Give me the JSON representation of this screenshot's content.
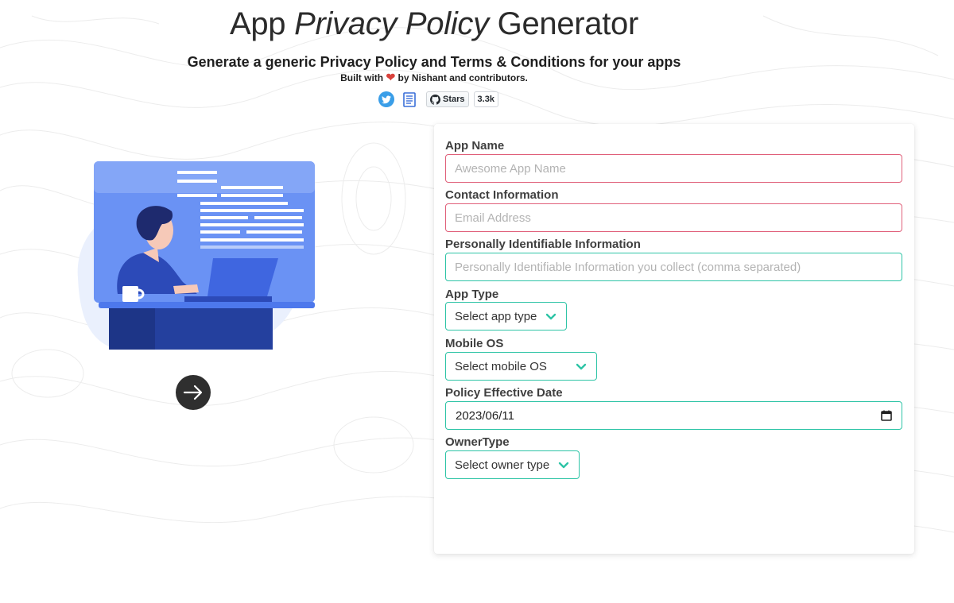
{
  "header": {
    "title_part1": "App ",
    "title_part2": "Privacy Policy",
    "title_part3": " Generator",
    "subtitle": "Generate a generic Privacy Policy and Terms & Conditions for your apps",
    "built_prefix": "Built with ",
    "built_suffix": " by Nishant and contributors."
  },
  "social": {
    "github_stars_label": "Stars",
    "github_stars_count": "3.3k"
  },
  "form": {
    "app_name_label": "App Name",
    "app_name_placeholder": "Awesome App Name",
    "contact_label": "Contact Information",
    "contact_placeholder": "Email Address",
    "pii_label": "Personally Identifiable Information",
    "pii_placeholder": "Personally Identifiable Information you collect (comma separated)",
    "app_type_label": "App Type",
    "app_type_value": "Select app type",
    "mobile_os_label": "Mobile OS",
    "mobile_os_value": "Select mobile OS",
    "effective_date_label": "Policy Effective Date",
    "effective_date_value": "2023/06/11",
    "owner_type_label": "OwnerType",
    "owner_type_value": "Select owner type"
  },
  "colors": {
    "accent": "#2ec4a6",
    "error_border": "#e0607a",
    "illustration_blue": "#5b86f0",
    "heart": "#d9423c"
  },
  "icons": [
    "twitter-icon",
    "document-icon",
    "github-icon",
    "heart-icon",
    "arrow-right-icon",
    "chevron-down-icon",
    "calendar-icon"
  ]
}
